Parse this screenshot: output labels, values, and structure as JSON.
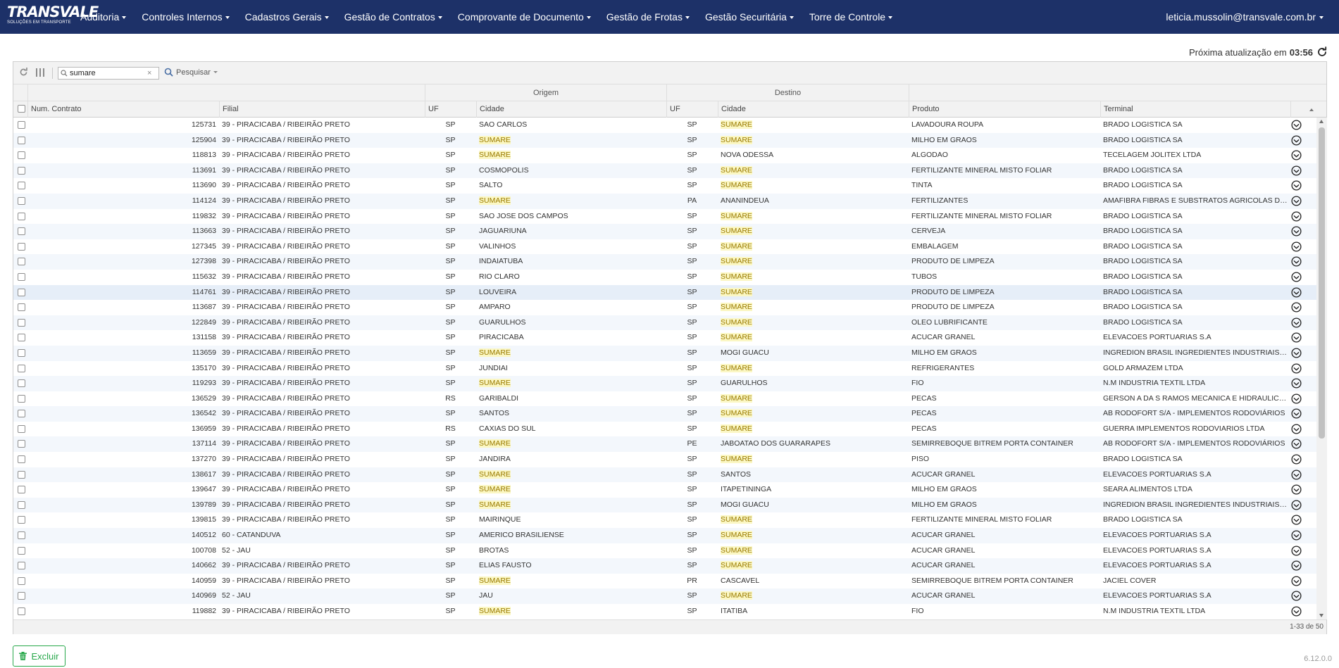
{
  "navbar": {
    "logo_text": "TRANSVALE",
    "logo_subtitle": "SOLUÇÕES EM TRANSPORTE",
    "items": [
      {
        "label": "Auditoria"
      },
      {
        "label": "Controles Internos"
      },
      {
        "label": "Cadastros Gerais"
      },
      {
        "label": "Gestão de Contratos"
      },
      {
        "label": "Comprovante de Documento"
      },
      {
        "label": "Gestão de Frotas"
      },
      {
        "label": "Gestão Securitária"
      },
      {
        "label": "Torre de Controle"
      }
    ],
    "user": "leticia.mussolin@transvale.com.br"
  },
  "next_update": {
    "label": "Próxima atualização em",
    "time": "03:56"
  },
  "toolbar": {
    "search_value": "sumare",
    "search_button": "Pesquisar"
  },
  "group_headers": {
    "origem": "Origem",
    "destino": "Destino"
  },
  "columns": {
    "num_contrato": "Num. Contrato",
    "filial": "Filial",
    "uf_origem": "UF",
    "cidade_origem": "Cidade",
    "uf_destino": "UF",
    "cidade_destino": "Cidade",
    "produto": "Produto",
    "terminal": "Terminal"
  },
  "highlight_term": "SUMARE",
  "rows": [
    {
      "num": "125731",
      "filial": "39 - PIRACICABA / RIBEIRÃO PRETO",
      "uf_o": "SP",
      "cid_o": "SAO CARLOS",
      "uf_d": "SP",
      "cid_d": "SUMARE",
      "produto": "LAVADOURA ROUPA",
      "terminal": "BRADO LOGISTICA SA"
    },
    {
      "num": "125904",
      "filial": "39 - PIRACICABA / RIBEIRÃO PRETO",
      "uf_o": "SP",
      "cid_o": "SUMARE",
      "uf_d": "SP",
      "cid_d": "SUMARE",
      "produto": "MILHO EM GRAOS",
      "terminal": "BRADO LOGISTICA SA"
    },
    {
      "num": "118813",
      "filial": "39 - PIRACICABA / RIBEIRÃO PRETO",
      "uf_o": "SP",
      "cid_o": "SUMARE",
      "uf_d": "SP",
      "cid_d": "NOVA ODESSA",
      "produto": "ALGODAO",
      "terminal": "TECELAGEM JOLITEX LTDA"
    },
    {
      "num": "113691",
      "filial": "39 - PIRACICABA / RIBEIRÃO PRETO",
      "uf_o": "SP",
      "cid_o": "COSMOPOLIS",
      "uf_d": "SP",
      "cid_d": "SUMARE",
      "produto": "FERTILIZANTE MINERAL MISTO FOLIAR",
      "terminal": "BRADO LOGISTICA SA"
    },
    {
      "num": "113690",
      "filial": "39 - PIRACICABA / RIBEIRÃO PRETO",
      "uf_o": "SP",
      "cid_o": "SALTO",
      "uf_d": "SP",
      "cid_d": "SUMARE",
      "produto": "TINTA",
      "terminal": "BRADO LOGISTICA SA"
    },
    {
      "num": "114124",
      "filial": "39 - PIRACICABA / RIBEIRÃO PRETO",
      "uf_o": "SP",
      "cid_o": "SUMARE",
      "uf_d": "PA",
      "cid_d": "ANANINDEUA",
      "produto": "FERTILIZANTES",
      "terminal": "AMAFIBRA FIBRAS E SUBSTRATOS AGRICOLAS DA..."
    },
    {
      "num": "119832",
      "filial": "39 - PIRACICABA / RIBEIRÃO PRETO",
      "uf_o": "SP",
      "cid_o": "SAO JOSE DOS CAMPOS",
      "uf_d": "SP",
      "cid_d": "SUMARE",
      "produto": "FERTILIZANTE MINERAL MISTO FOLIAR",
      "terminal": "BRADO LOGISTICA SA"
    },
    {
      "num": "113663",
      "filial": "39 - PIRACICABA / RIBEIRÃO PRETO",
      "uf_o": "SP",
      "cid_o": "JAGUARIUNA",
      "uf_d": "SP",
      "cid_d": "SUMARE",
      "produto": "CERVEJA",
      "terminal": "BRADO LOGISTICA SA"
    },
    {
      "num": "127345",
      "filial": "39 - PIRACICABA / RIBEIRÃO PRETO",
      "uf_o": "SP",
      "cid_o": "VALINHOS",
      "uf_d": "SP",
      "cid_d": "SUMARE",
      "produto": "EMBALAGEM",
      "terminal": "BRADO LOGISTICA SA"
    },
    {
      "num": "127398",
      "filial": "39 - PIRACICABA / RIBEIRÃO PRETO",
      "uf_o": "SP",
      "cid_o": "INDAIATUBA",
      "uf_d": "SP",
      "cid_d": "SUMARE",
      "produto": "PRODUTO DE LIMPEZA",
      "terminal": "BRADO LOGISTICA SA"
    },
    {
      "num": "115632",
      "filial": "39 - PIRACICABA / RIBEIRÃO PRETO",
      "uf_o": "SP",
      "cid_o": "RIO CLARO",
      "uf_d": "SP",
      "cid_d": "SUMARE",
      "produto": "TUBOS",
      "terminal": "BRADO LOGISTICA SA"
    },
    {
      "num": "114761",
      "filial": "39 - PIRACICABA / RIBEIRÃO PRETO",
      "uf_o": "SP",
      "cid_o": "LOUVEIRA",
      "uf_d": "SP",
      "cid_d": "SUMARE",
      "produto": "PRODUTO DE LIMPEZA",
      "terminal": "BRADO LOGISTICA SA"
    },
    {
      "num": "113687",
      "filial": "39 - PIRACICABA / RIBEIRÃO PRETO",
      "uf_o": "SP",
      "cid_o": "AMPARO",
      "uf_d": "SP",
      "cid_d": "SUMARE",
      "produto": "PRODUTO DE LIMPEZA",
      "terminal": "BRADO LOGISTICA SA"
    },
    {
      "num": "122849",
      "filial": "39 - PIRACICABA / RIBEIRÃO PRETO",
      "uf_o": "SP",
      "cid_o": "GUARULHOS",
      "uf_d": "SP",
      "cid_d": "SUMARE",
      "produto": "OLEO LUBRIFICANTE",
      "terminal": "BRADO LOGISTICA SA"
    },
    {
      "num": "131158",
      "filial": "39 - PIRACICABA / RIBEIRÃO PRETO",
      "uf_o": "SP",
      "cid_o": "PIRACICABA",
      "uf_d": "SP",
      "cid_d": "SUMARE",
      "produto": "ACUCAR GRANEL",
      "terminal": "ELEVACOES PORTUARIAS S.A"
    },
    {
      "num": "113659",
      "filial": "39 - PIRACICABA / RIBEIRÃO PRETO",
      "uf_o": "SP",
      "cid_o": "SUMARE",
      "uf_d": "SP",
      "cid_d": "MOGI GUACU",
      "produto": "MILHO EM GRAOS",
      "terminal": "INGREDION BRASIL INGREDIENTES INDUSTRIAIS ..."
    },
    {
      "num": "135170",
      "filial": "39 - PIRACICABA / RIBEIRÃO PRETO",
      "uf_o": "SP",
      "cid_o": "JUNDIAI",
      "uf_d": "SP",
      "cid_d": "SUMARE",
      "produto": "REFRIGERANTES",
      "terminal": "GOLD ARMAZEM LTDA"
    },
    {
      "num": "119293",
      "filial": "39 - PIRACICABA / RIBEIRÃO PRETO",
      "uf_o": "SP",
      "cid_o": "SUMARE",
      "uf_d": "SP",
      "cid_d": "GUARULHOS",
      "produto": "FIO",
      "terminal": "N.M INDUSTRIA TEXTIL LTDA"
    },
    {
      "num": "136529",
      "filial": "39 - PIRACICABA / RIBEIRÃO PRETO",
      "uf_o": "RS",
      "cid_o": "GARIBALDI",
      "uf_d": "SP",
      "cid_d": "SUMARE",
      "produto": "PECAS",
      "terminal": "GERSON A DA S RAMOS MECANICA E HIDRAULICO..."
    },
    {
      "num": "136542",
      "filial": "39 - PIRACICABA / RIBEIRÃO PRETO",
      "uf_o": "SP",
      "cid_o": "SANTOS",
      "uf_d": "SP",
      "cid_d": "SUMARE",
      "produto": "PECAS",
      "terminal": "AB RODOFORT S/A - IMPLEMENTOS RODOVIÁRIOS"
    },
    {
      "num": "136959",
      "filial": "39 - PIRACICABA / RIBEIRÃO PRETO",
      "uf_o": "RS",
      "cid_o": "CAXIAS DO SUL",
      "uf_d": "SP",
      "cid_d": "SUMARE",
      "produto": "PECAS",
      "terminal": "GUERRA IMPLEMENTOS RODOVIARIOS LTDA"
    },
    {
      "num": "137114",
      "filial": "39 - PIRACICABA / RIBEIRÃO PRETO",
      "uf_o": "SP",
      "cid_o": "SUMARE",
      "uf_d": "PE",
      "cid_d": "JABOATAO DOS GUARARAPES",
      "produto": "SEMIRREBOQUE BITREM PORTA CONTAINER",
      "terminal": "AB RODOFORT S/A - IMPLEMENTOS RODOVIÁRIOS"
    },
    {
      "num": "137270",
      "filial": "39 - PIRACICABA / RIBEIRÃO PRETO",
      "uf_o": "SP",
      "cid_o": "JANDIRA",
      "uf_d": "SP",
      "cid_d": "SUMARE",
      "produto": "PISO",
      "terminal": "BRADO LOGISTICA SA"
    },
    {
      "num": "138617",
      "filial": "39 - PIRACICABA / RIBEIRÃO PRETO",
      "uf_o": "SP",
      "cid_o": "SUMARE",
      "uf_d": "SP",
      "cid_d": "SANTOS",
      "produto": "ACUCAR GRANEL",
      "terminal": "ELEVACOES PORTUARIAS S.A"
    },
    {
      "num": "139647",
      "filial": "39 - PIRACICABA / RIBEIRÃO PRETO",
      "uf_o": "SP",
      "cid_o": "SUMARE",
      "uf_d": "SP",
      "cid_d": "ITAPETININGA",
      "produto": "MILHO EM GRAOS",
      "terminal": "SEARA ALIMENTOS LTDA"
    },
    {
      "num": "139789",
      "filial": "39 - PIRACICABA / RIBEIRÃO PRETO",
      "uf_o": "SP",
      "cid_o": "SUMARE",
      "uf_d": "SP",
      "cid_d": "MOGI GUACU",
      "produto": "MILHO EM GRAOS",
      "terminal": "INGREDION BRASIL INGREDIENTES INDUSTRIAIS ..."
    },
    {
      "num": "139815",
      "filial": "39 - PIRACICABA / RIBEIRÃO PRETO",
      "uf_o": "SP",
      "cid_o": "MAIRINQUE",
      "uf_d": "SP",
      "cid_d": "SUMARE",
      "produto": "FERTILIZANTE MINERAL MISTO FOLIAR",
      "terminal": "BRADO LOGISTICA SA"
    },
    {
      "num": "140512",
      "filial": "60 - CATANDUVA",
      "uf_o": "SP",
      "cid_o": "AMERICO BRASILIENSE",
      "uf_d": "SP",
      "cid_d": "SUMARE",
      "produto": "ACUCAR GRANEL",
      "terminal": "ELEVACOES PORTUARIAS S.A"
    },
    {
      "num": "100708",
      "filial": "52 - JAU",
      "uf_o": "SP",
      "cid_o": "BROTAS",
      "uf_d": "SP",
      "cid_d": "SUMARE",
      "produto": "ACUCAR GRANEL",
      "terminal": "ELEVACOES PORTUARIAS S.A"
    },
    {
      "num": "140662",
      "filial": "39 - PIRACICABA / RIBEIRÃO PRETO",
      "uf_o": "SP",
      "cid_o": "ELIAS FAUSTO",
      "uf_d": "SP",
      "cid_d": "SUMARE",
      "produto": "ACUCAR GRANEL",
      "terminal": "ELEVACOES PORTUARIAS S.A"
    },
    {
      "num": "140959",
      "filial": "39 - PIRACICABA / RIBEIRÃO PRETO",
      "uf_o": "SP",
      "cid_o": "SUMARE",
      "uf_d": "PR",
      "cid_d": "CASCAVEL",
      "produto": "SEMIRREBOQUE BITREM PORTA CONTAINER",
      "terminal": "JACIEL COVER"
    },
    {
      "num": "140969",
      "filial": "52 - JAU",
      "uf_o": "SP",
      "cid_o": "JAU",
      "uf_d": "SP",
      "cid_d": "SUMARE",
      "produto": "ACUCAR GRANEL",
      "terminal": "ELEVACOES PORTUARIAS S.A"
    },
    {
      "num": "119882",
      "filial": "39 - PIRACICABA / RIBEIRÃO PRETO",
      "uf_o": "SP",
      "cid_o": "SUMARE",
      "uf_d": "SP",
      "cid_d": "ITATIBA",
      "produto": "FIO",
      "terminal": "N.M INDUSTRIA TEXTIL LTDA"
    }
  ],
  "highlighted_row": 11,
  "pagination": "1-33 de 50",
  "actions": {
    "delete_label": "Excluir"
  },
  "version": "6.12.0.0",
  "colors": {
    "navbar": "#1d3168",
    "accent_green": "#27a84a",
    "match_highlight": "#fbf7c4"
  }
}
